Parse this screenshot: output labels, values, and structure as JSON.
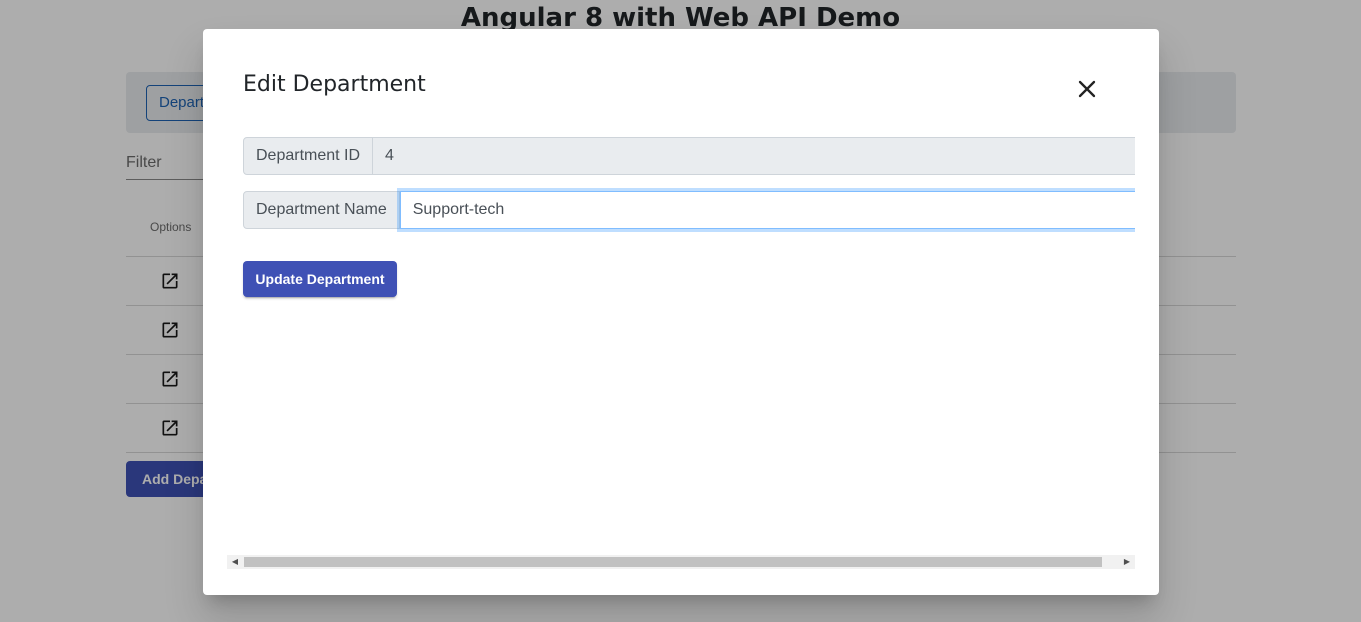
{
  "page": {
    "title": "Angular 8 with Web API Demo"
  },
  "nav": {
    "department_button": "Department"
  },
  "filter": {
    "label": "Filter"
  },
  "table": {
    "options_header": "Options",
    "row_count": 4
  },
  "add_button": "Add Department",
  "modal": {
    "title": "Edit Department",
    "close_icon": "close-icon",
    "fields": {
      "id_label": "Department ID",
      "id_value": "4",
      "name_label": "Department Name",
      "name_value": "Support-tech"
    },
    "update_button": "Update Department"
  },
  "colors": {
    "primary": "#3f51b5",
    "outline_blue": "#1e64b4",
    "focus_border": "#80bdff"
  }
}
